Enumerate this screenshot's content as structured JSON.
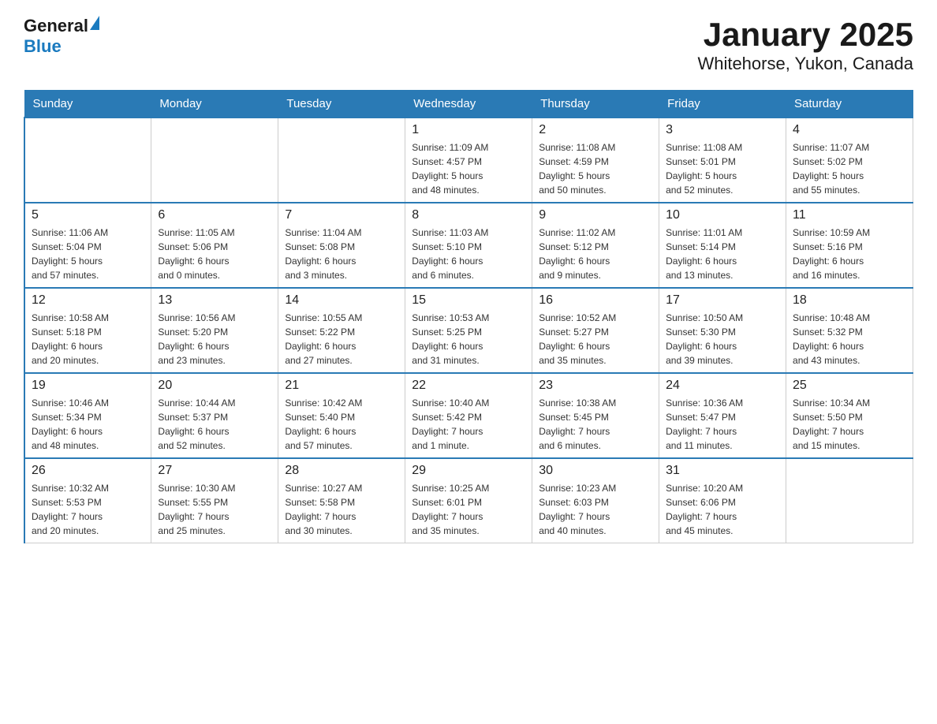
{
  "header": {
    "logo_general": "General",
    "logo_blue": "Blue",
    "title": "January 2025",
    "subtitle": "Whitehorse, Yukon, Canada"
  },
  "days_of_week": [
    "Sunday",
    "Monday",
    "Tuesday",
    "Wednesday",
    "Thursday",
    "Friday",
    "Saturday"
  ],
  "weeks": [
    [
      {
        "day": "",
        "info": ""
      },
      {
        "day": "",
        "info": ""
      },
      {
        "day": "",
        "info": ""
      },
      {
        "day": "1",
        "info": "Sunrise: 11:09 AM\nSunset: 4:57 PM\nDaylight: 5 hours\nand 48 minutes."
      },
      {
        "day": "2",
        "info": "Sunrise: 11:08 AM\nSunset: 4:59 PM\nDaylight: 5 hours\nand 50 minutes."
      },
      {
        "day": "3",
        "info": "Sunrise: 11:08 AM\nSunset: 5:01 PM\nDaylight: 5 hours\nand 52 minutes."
      },
      {
        "day": "4",
        "info": "Sunrise: 11:07 AM\nSunset: 5:02 PM\nDaylight: 5 hours\nand 55 minutes."
      }
    ],
    [
      {
        "day": "5",
        "info": "Sunrise: 11:06 AM\nSunset: 5:04 PM\nDaylight: 5 hours\nand 57 minutes."
      },
      {
        "day": "6",
        "info": "Sunrise: 11:05 AM\nSunset: 5:06 PM\nDaylight: 6 hours\nand 0 minutes."
      },
      {
        "day": "7",
        "info": "Sunrise: 11:04 AM\nSunset: 5:08 PM\nDaylight: 6 hours\nand 3 minutes."
      },
      {
        "day": "8",
        "info": "Sunrise: 11:03 AM\nSunset: 5:10 PM\nDaylight: 6 hours\nand 6 minutes."
      },
      {
        "day": "9",
        "info": "Sunrise: 11:02 AM\nSunset: 5:12 PM\nDaylight: 6 hours\nand 9 minutes."
      },
      {
        "day": "10",
        "info": "Sunrise: 11:01 AM\nSunset: 5:14 PM\nDaylight: 6 hours\nand 13 minutes."
      },
      {
        "day": "11",
        "info": "Sunrise: 10:59 AM\nSunset: 5:16 PM\nDaylight: 6 hours\nand 16 minutes."
      }
    ],
    [
      {
        "day": "12",
        "info": "Sunrise: 10:58 AM\nSunset: 5:18 PM\nDaylight: 6 hours\nand 20 minutes."
      },
      {
        "day": "13",
        "info": "Sunrise: 10:56 AM\nSunset: 5:20 PM\nDaylight: 6 hours\nand 23 minutes."
      },
      {
        "day": "14",
        "info": "Sunrise: 10:55 AM\nSunset: 5:22 PM\nDaylight: 6 hours\nand 27 minutes."
      },
      {
        "day": "15",
        "info": "Sunrise: 10:53 AM\nSunset: 5:25 PM\nDaylight: 6 hours\nand 31 minutes."
      },
      {
        "day": "16",
        "info": "Sunrise: 10:52 AM\nSunset: 5:27 PM\nDaylight: 6 hours\nand 35 minutes."
      },
      {
        "day": "17",
        "info": "Sunrise: 10:50 AM\nSunset: 5:30 PM\nDaylight: 6 hours\nand 39 minutes."
      },
      {
        "day": "18",
        "info": "Sunrise: 10:48 AM\nSunset: 5:32 PM\nDaylight: 6 hours\nand 43 minutes."
      }
    ],
    [
      {
        "day": "19",
        "info": "Sunrise: 10:46 AM\nSunset: 5:34 PM\nDaylight: 6 hours\nand 48 minutes."
      },
      {
        "day": "20",
        "info": "Sunrise: 10:44 AM\nSunset: 5:37 PM\nDaylight: 6 hours\nand 52 minutes."
      },
      {
        "day": "21",
        "info": "Sunrise: 10:42 AM\nSunset: 5:40 PM\nDaylight: 6 hours\nand 57 minutes."
      },
      {
        "day": "22",
        "info": "Sunrise: 10:40 AM\nSunset: 5:42 PM\nDaylight: 7 hours\nand 1 minute."
      },
      {
        "day": "23",
        "info": "Sunrise: 10:38 AM\nSunset: 5:45 PM\nDaylight: 7 hours\nand 6 minutes."
      },
      {
        "day": "24",
        "info": "Sunrise: 10:36 AM\nSunset: 5:47 PM\nDaylight: 7 hours\nand 11 minutes."
      },
      {
        "day": "25",
        "info": "Sunrise: 10:34 AM\nSunset: 5:50 PM\nDaylight: 7 hours\nand 15 minutes."
      }
    ],
    [
      {
        "day": "26",
        "info": "Sunrise: 10:32 AM\nSunset: 5:53 PM\nDaylight: 7 hours\nand 20 minutes."
      },
      {
        "day": "27",
        "info": "Sunrise: 10:30 AM\nSunset: 5:55 PM\nDaylight: 7 hours\nand 25 minutes."
      },
      {
        "day": "28",
        "info": "Sunrise: 10:27 AM\nSunset: 5:58 PM\nDaylight: 7 hours\nand 30 minutes."
      },
      {
        "day": "29",
        "info": "Sunrise: 10:25 AM\nSunset: 6:01 PM\nDaylight: 7 hours\nand 35 minutes."
      },
      {
        "day": "30",
        "info": "Sunrise: 10:23 AM\nSunset: 6:03 PM\nDaylight: 7 hours\nand 40 minutes."
      },
      {
        "day": "31",
        "info": "Sunrise: 10:20 AM\nSunset: 6:06 PM\nDaylight: 7 hours\nand 45 minutes."
      },
      {
        "day": "",
        "info": ""
      }
    ]
  ]
}
